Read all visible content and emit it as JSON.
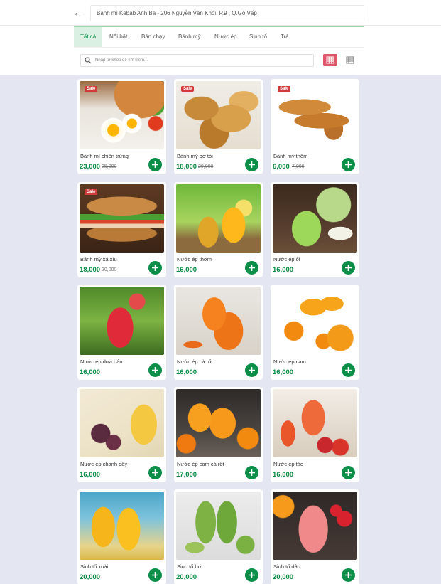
{
  "header": {
    "address": "Bánh mì Kebab Anh Ba - 206 Nguyễn Văn Khối, P.9 , Q.Gò Vấp",
    "back_icon": "arrow-left-icon"
  },
  "tabs": [
    {
      "label": "Tất cả",
      "active": true
    },
    {
      "label": "Nổi bật"
    },
    {
      "label": "Bán chạy"
    },
    {
      "label": "Bánh mỳ"
    },
    {
      "label": "Nước ép"
    },
    {
      "label": "Sinh tố"
    },
    {
      "label": "Trà"
    }
  ],
  "search": {
    "placeholder": "Nhập từ khóa để tìm kiếm...",
    "value": ""
  },
  "view_toggle": {
    "active": "grid",
    "accent": "#e0566b"
  },
  "colors": {
    "price": "#0b8c45",
    "add_button": "#0b8f48",
    "sale_badge": "#d23b3b",
    "active_tab_bg": "#d9f0e2"
  },
  "products": [
    {
      "name": "Bánh mì chiên trứng",
      "price": "23,000",
      "old_price": "25,000",
      "sale": "Sale",
      "image": "fried-egg-bread"
    },
    {
      "name": "Bánh mỳ bơ tỏi",
      "price": "18,000",
      "old_price": "20,000",
      "sale": "Sale",
      "image": "garlic-butter-bread"
    },
    {
      "name": "Bánh mỳ thêm",
      "price": "6,000",
      "old_price": "7,000",
      "sale": "Sale",
      "image": "baguettes"
    },
    {
      "name": "Bánh mỳ xá xíu",
      "price": "18,000",
      "old_price": "20,000",
      "sale": "Sale",
      "image": "char-siu-sandwich"
    },
    {
      "name": "Nước ép thơm",
      "price": "16,000",
      "image": "pineapple-juice"
    },
    {
      "name": "Nước ép ổi",
      "price": "16,000",
      "image": "guava-juice"
    },
    {
      "name": "Nước ép dưa hấu",
      "price": "16,000",
      "image": "watermelon-juice"
    },
    {
      "name": "Nước ép cà rốt",
      "price": "16,000",
      "image": "carrot-juice"
    },
    {
      "name": "Nước ép cam",
      "price": "16,000",
      "image": "orange-juice"
    },
    {
      "name": "Nước ép chanh dây",
      "price": "16,000",
      "image": "passion-fruit-juice"
    },
    {
      "name": "Nước ép cam cà rốt",
      "price": "17,000",
      "image": "orange-carrot-juice"
    },
    {
      "name": "Nước ép táo",
      "price": "16,000",
      "image": "apple-juice"
    },
    {
      "name": "Sinh tố xoài",
      "price": "20,000",
      "image": "mango-smoothie"
    },
    {
      "name": "Sinh tố bơ",
      "price": "20,000",
      "image": "avocado-smoothie"
    },
    {
      "name": "Sinh tố dâu",
      "price": "20,000",
      "image": "strawberry-smoothie"
    }
  ]
}
